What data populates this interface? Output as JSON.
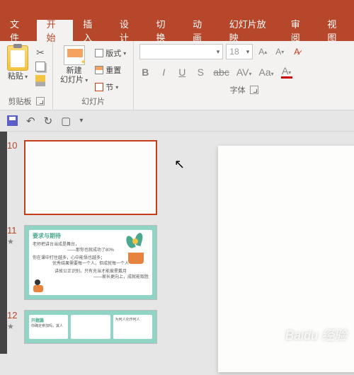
{
  "tabs": {
    "file": "文件",
    "home": "开始",
    "insert": "插入",
    "design": "设计",
    "transition": "切换",
    "animation": "动画",
    "slideshow": "幻灯片放映",
    "review": "审阅",
    "view": "视图"
  },
  "ribbon": {
    "clipboard": {
      "paste": "粘贴",
      "label": "剪贴板"
    },
    "slides": {
      "new": "新建\n幻灯片",
      "layout": "版式",
      "reset": "重置",
      "section": "节",
      "label": "幻灯片"
    },
    "font": {
      "size": "18",
      "increase": "A",
      "decrease": "A",
      "b": "B",
      "i": "I",
      "u": "U",
      "s": "S",
      "spacing": "abc",
      "av": "AV",
      "aa": "Aa",
      "color": "A",
      "label": "字体"
    }
  },
  "thumbs": {
    "n10": "10",
    "n11": "11",
    "n12": "12",
    "s11": {
      "title": "要求与期待",
      "l1": "老师把讲台当成是舞台，",
      "l2": "——那你也就成功了80%",
      "l3": "你在课中打住越多，心中能悟也越多；",
      "l4": "优秀结果需要每一个人，但成就每一个人",
      "l5": "讲故公正识别，只有充当才能披星戴月",
      "l6": "——家长更向上，成就能取胜"
    },
    "s12": {
      "title": "开题篇",
      "a": "你确定参加吗，其人",
      "b": "为何人化作何人"
    }
  },
  "watermark": "Baidu 经验"
}
